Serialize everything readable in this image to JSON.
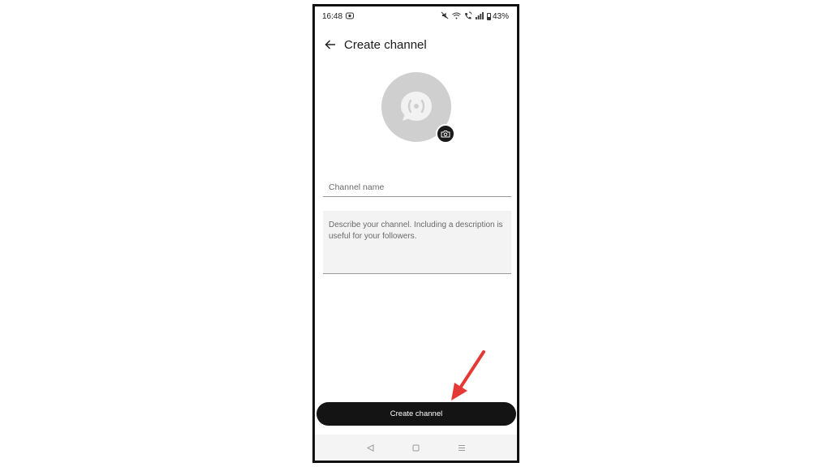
{
  "status_bar": {
    "time": "16:48",
    "battery_percent": "43%",
    "battery_level": 0.43,
    "icons": [
      "notification-icon",
      "mute-icon",
      "wifi-icon",
      "wifi-calling-icon",
      "signal-icon",
      "battery-icon"
    ]
  },
  "header": {
    "title": "Create channel",
    "back_icon": "arrow-left-icon"
  },
  "avatar": {
    "icon": "channel-broadcast-icon",
    "camera_icon": "camera-icon"
  },
  "form": {
    "name_placeholder": "Channel name",
    "name_value": "",
    "description_placeholder": "Describe your channel. Including a description is useful for your followers.",
    "description_value": ""
  },
  "actions": {
    "create_label": "Create channel"
  },
  "nav": {
    "icons": [
      "back-triangle-icon",
      "home-square-icon",
      "recents-menu-icon"
    ]
  },
  "colors": {
    "button_bg": "#141414",
    "avatar_bg": "#cfcfcf",
    "annotation_arrow": "#e53935"
  }
}
